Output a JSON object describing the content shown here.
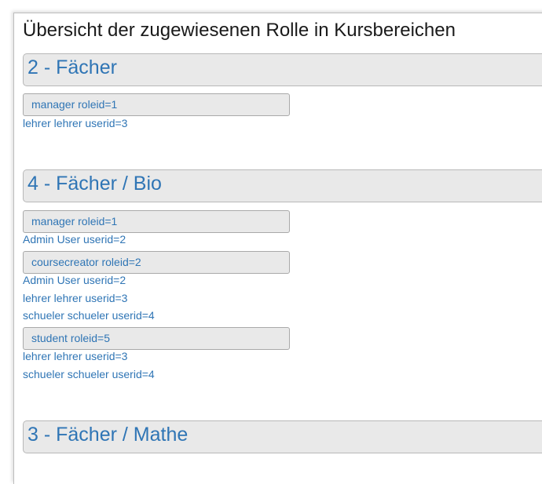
{
  "page_title": "Übersicht der zugewiesenen Rolle in Kursbereichen",
  "colors": {
    "link": "#2f75b5",
    "header_bg": "#e9e9e9",
    "title": "#1a1a1a"
  },
  "categories": [
    {
      "title": "2 - Fächer",
      "roles": [
        {
          "label": "manager roleid=1",
          "users": [
            "lehrer lehrer userid=3"
          ]
        }
      ]
    },
    {
      "title": "4 - Fächer / Bio",
      "roles": [
        {
          "label": "manager roleid=1",
          "users": [
            "Admin User userid=2"
          ]
        },
        {
          "label": "coursecreator roleid=2",
          "users": [
            "Admin User userid=2",
            "lehrer lehrer userid=3",
            "schueler schueler userid=4"
          ]
        },
        {
          "label": "student roleid=5",
          "users": [
            "lehrer lehrer userid=3",
            "schueler schueler userid=4"
          ]
        }
      ]
    },
    {
      "title": "3 - Fächer / Mathe",
      "roles": []
    }
  ]
}
